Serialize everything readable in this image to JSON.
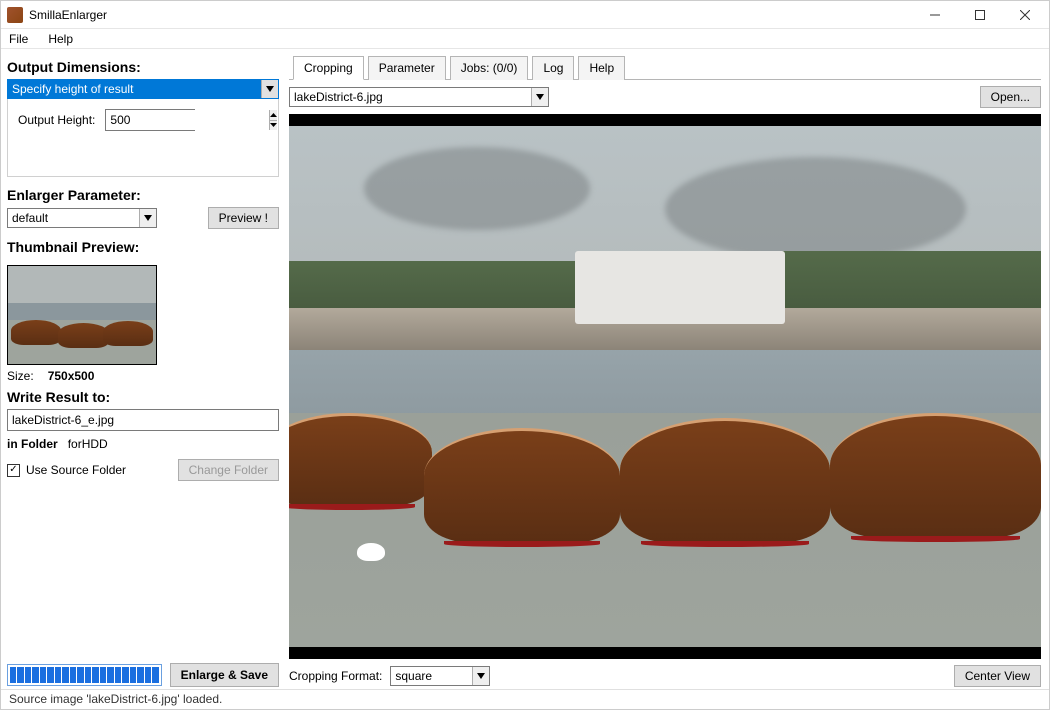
{
  "window": {
    "title": "SmillaEnlarger"
  },
  "menus": {
    "file": "File",
    "help": "Help"
  },
  "left": {
    "output_dimensions_title": "Output Dimensions:",
    "dimension_mode": "Specify height of result",
    "output_height_label": "Output Height:",
    "output_height_value": "500",
    "enlarger_parameter_title": "Enlarger Parameter:",
    "parameter_preset": "default",
    "preview_button": "Preview !",
    "thumbnail_title": "Thumbnail Preview:",
    "size_label": "Size:",
    "size_value": "750x500",
    "write_result_title": "Write Result to:",
    "output_filename": "lakeDistrict-6_e.jpg",
    "in_folder_label": "in Folder",
    "in_folder_value": "forHDD",
    "use_source_folder_label": "Use Source Folder",
    "use_source_folder_checked": true,
    "change_folder_button": "Change Folder",
    "enlarge_save_button": "Enlarge & Save"
  },
  "right": {
    "tabs": {
      "cropping": "Cropping",
      "parameter": "Parameter",
      "jobs": "Jobs: (0/0)",
      "log": "Log",
      "help": "Help"
    },
    "source_file": "lakeDistrict-6.jpg",
    "open_button": "Open...",
    "cropping_format_label": "Cropping Format:",
    "cropping_format_value": "square",
    "center_view_button": "Center View"
  },
  "statusbar": {
    "text": "Source image 'lakeDistrict-6.jpg' loaded."
  }
}
